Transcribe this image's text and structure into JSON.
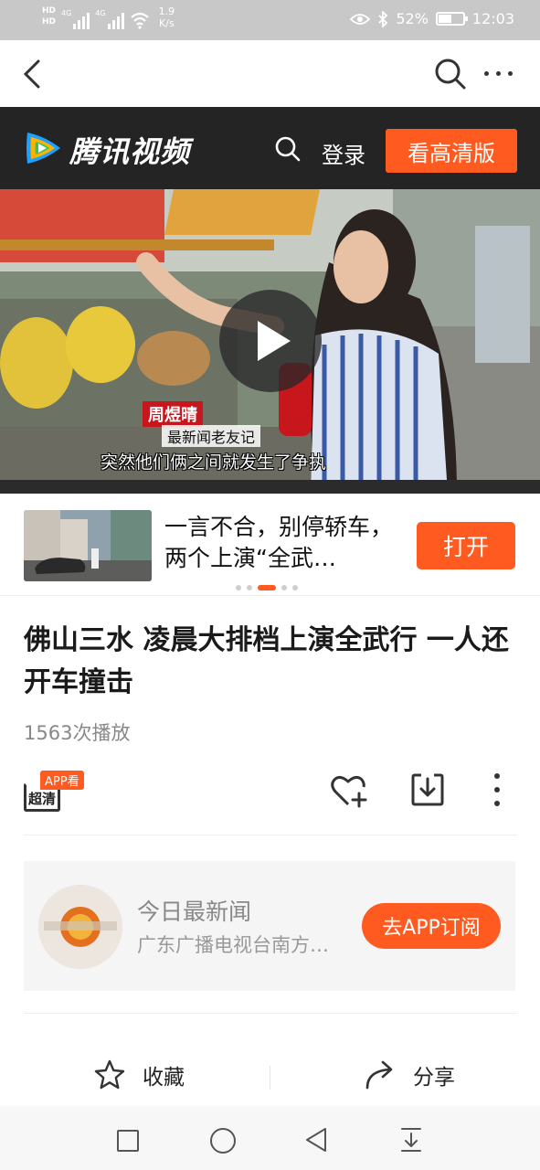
{
  "status_bar": {
    "network_label_1": "HD",
    "network_label_2": "HD",
    "signal_1": "4G",
    "signal_2": "4G",
    "net_speed_value": "1.9",
    "net_speed_unit": "K/s",
    "battery": "52%",
    "time": "12:03"
  },
  "header": {
    "brand": "腾讯视频",
    "login": "登录",
    "hd_version": "看高清版"
  },
  "video": {
    "caption_name": "周煜晴",
    "caption_role": "最新闻老友记",
    "caption_line": "突然他们俩之间就发生了争执"
  },
  "recommendation": {
    "title": "一言不合，别停轿车，两个上演“全武…",
    "open_button": "打开"
  },
  "article": {
    "title": "佛山三水 凌晨大排档上演全武行 一人还开车撞击",
    "plays": "1563次播放",
    "app_badge": "APP看",
    "quality": "超清"
  },
  "channel": {
    "name": "今日最新闻",
    "subtitle": "广东广播电视台南方…",
    "subscribe_button": "去APP订阅"
  },
  "bottom": {
    "collect": "收藏",
    "share": "分享"
  },
  "colors": {
    "accent": "#ff5a1f",
    "header_bg": "#242424",
    "status_bar_bg": "#c8c8c8"
  }
}
